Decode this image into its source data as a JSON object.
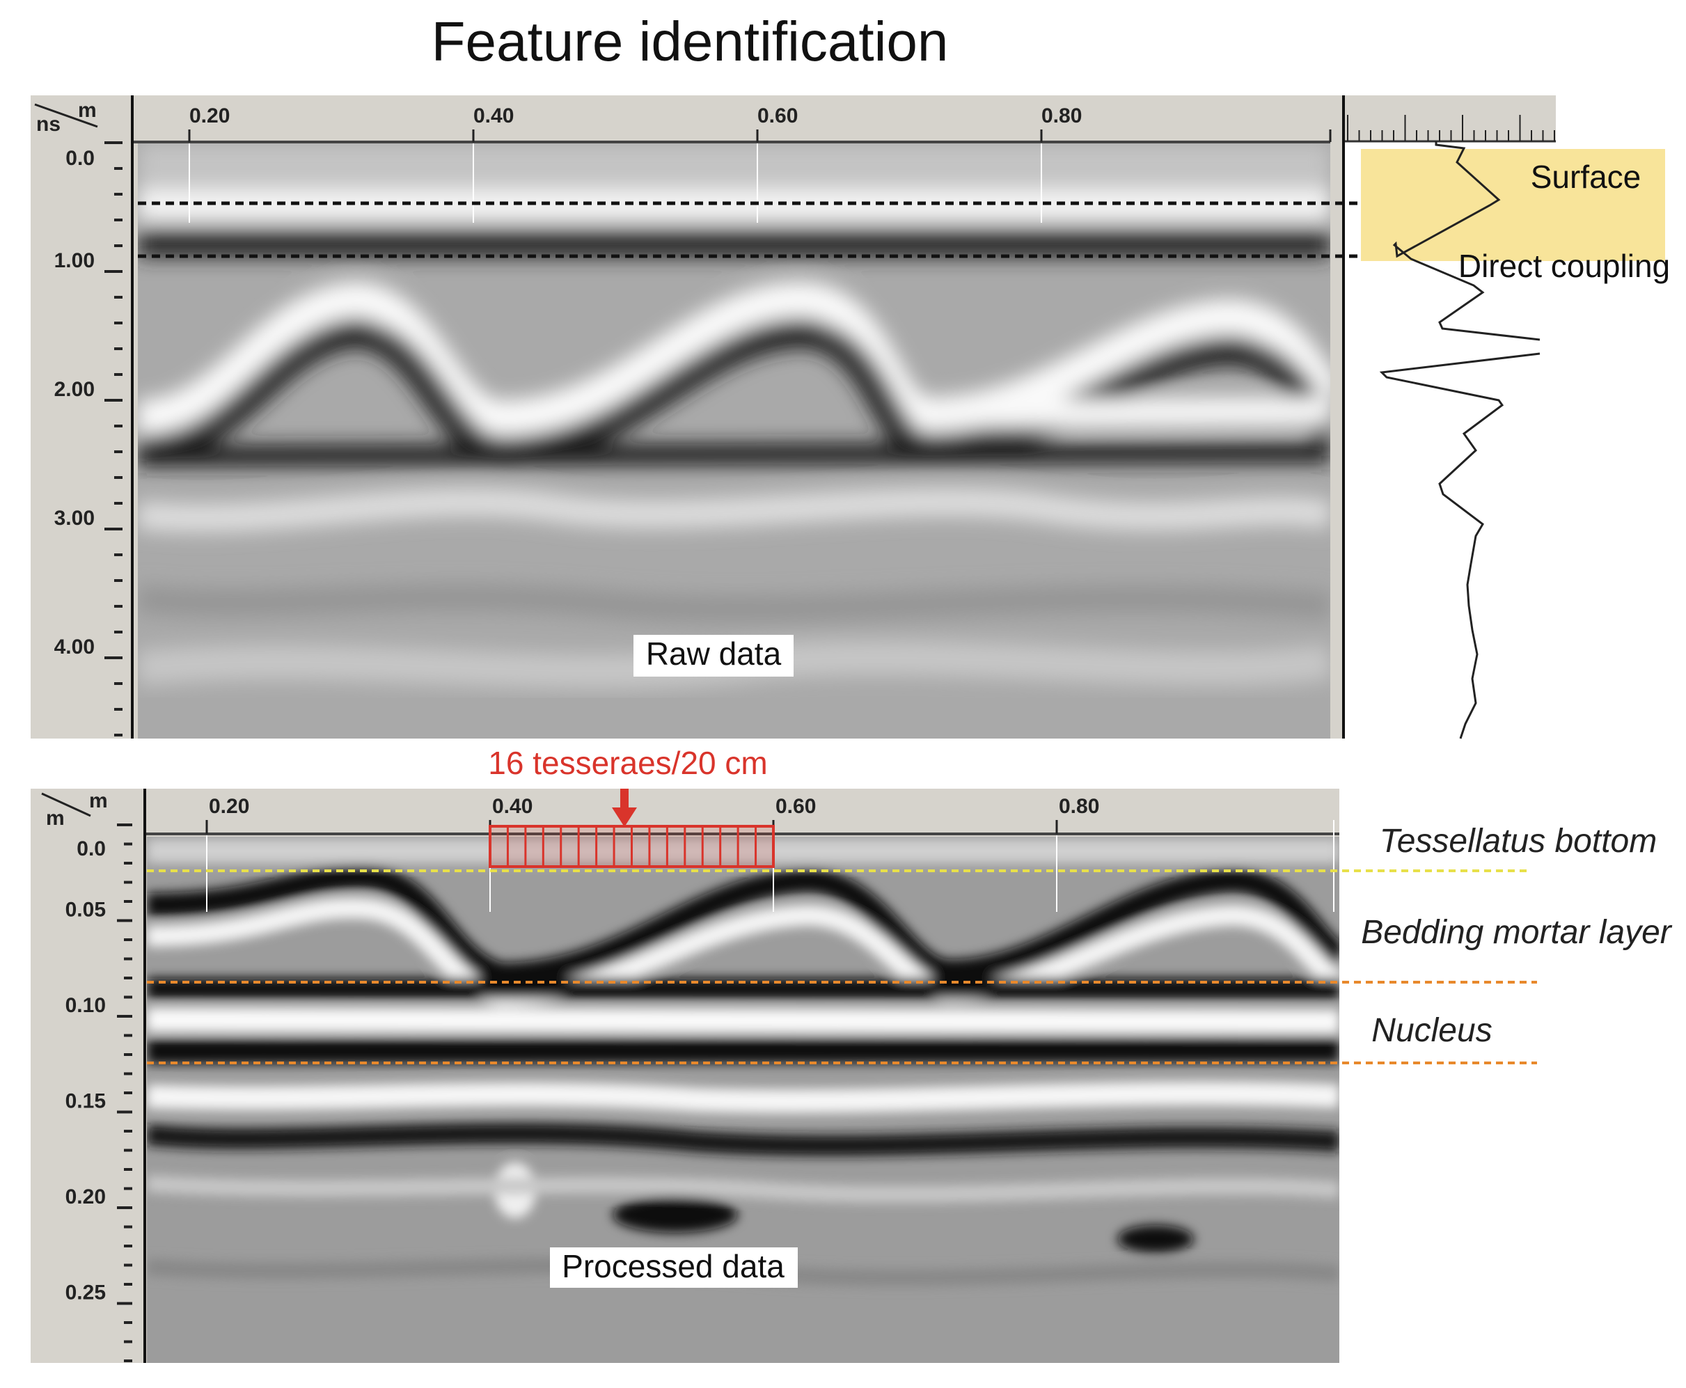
{
  "title": "Feature identification",
  "chart_data": [
    {
      "type": "heatmap",
      "name": "Raw data",
      "label": "Raw data",
      "corner_units": {
        "x": "m",
        "y": "ns"
      },
      "x_ticks": [
        "0.20",
        "0.40",
        "0.60",
        "0.80"
      ],
      "x_tick_values": [
        0.2,
        0.4,
        0.6,
        0.8
      ],
      "y_ticks": [
        "0.0",
        "1.00",
        "2.00",
        "3.00",
        "4.00"
      ],
      "y_tick_values": [
        0,
        1,
        2,
        3,
        4
      ],
      "xlim": [
        0.13,
        0.98
      ],
      "ylim": [
        0,
        4.6
      ],
      "dashed_lines_ns": [
        0.45,
        0.95
      ],
      "annotations": [
        {
          "text": "Surface",
          "highlight": "#f8e49a"
        },
        {
          "text": "Direct coupling"
        }
      ]
    },
    {
      "type": "heatmap",
      "name": "Processed data",
      "label": "Processed data",
      "corner_units": {
        "x": "m",
        "y": "m"
      },
      "x_ticks": [
        "0.20",
        "0.40",
        "0.60",
        "0.80"
      ],
      "x_tick_values": [
        0.2,
        0.4,
        0.6,
        0.8
      ],
      "y_ticks": [
        "0.0",
        "0.05",
        "0.10",
        "0.15",
        "0.20",
        "0.25"
      ],
      "y_tick_values": [
        0,
        0.05,
        0.1,
        0.15,
        0.2,
        0.25
      ],
      "xlim": [
        0.13,
        0.98
      ],
      "ylim": [
        0,
        0.275
      ],
      "tesserae": {
        "text": "16 tesseraes/20 cm",
        "count": 16,
        "from_m": 0.4,
        "to_m": 0.6,
        "color": "#d9342b"
      },
      "interfaces": [
        {
          "text": "Tessellatus bottom",
          "depth_m": 0.012,
          "color": "#e8e04a"
        },
        {
          "text": "Bedding mortar layer",
          "depth_m": 0.072,
          "color": "#e8892c"
        },
        {
          "text": "Nucleus",
          "depth_m": 0.116,
          "color": "#e8892c"
        }
      ]
    }
  ]
}
